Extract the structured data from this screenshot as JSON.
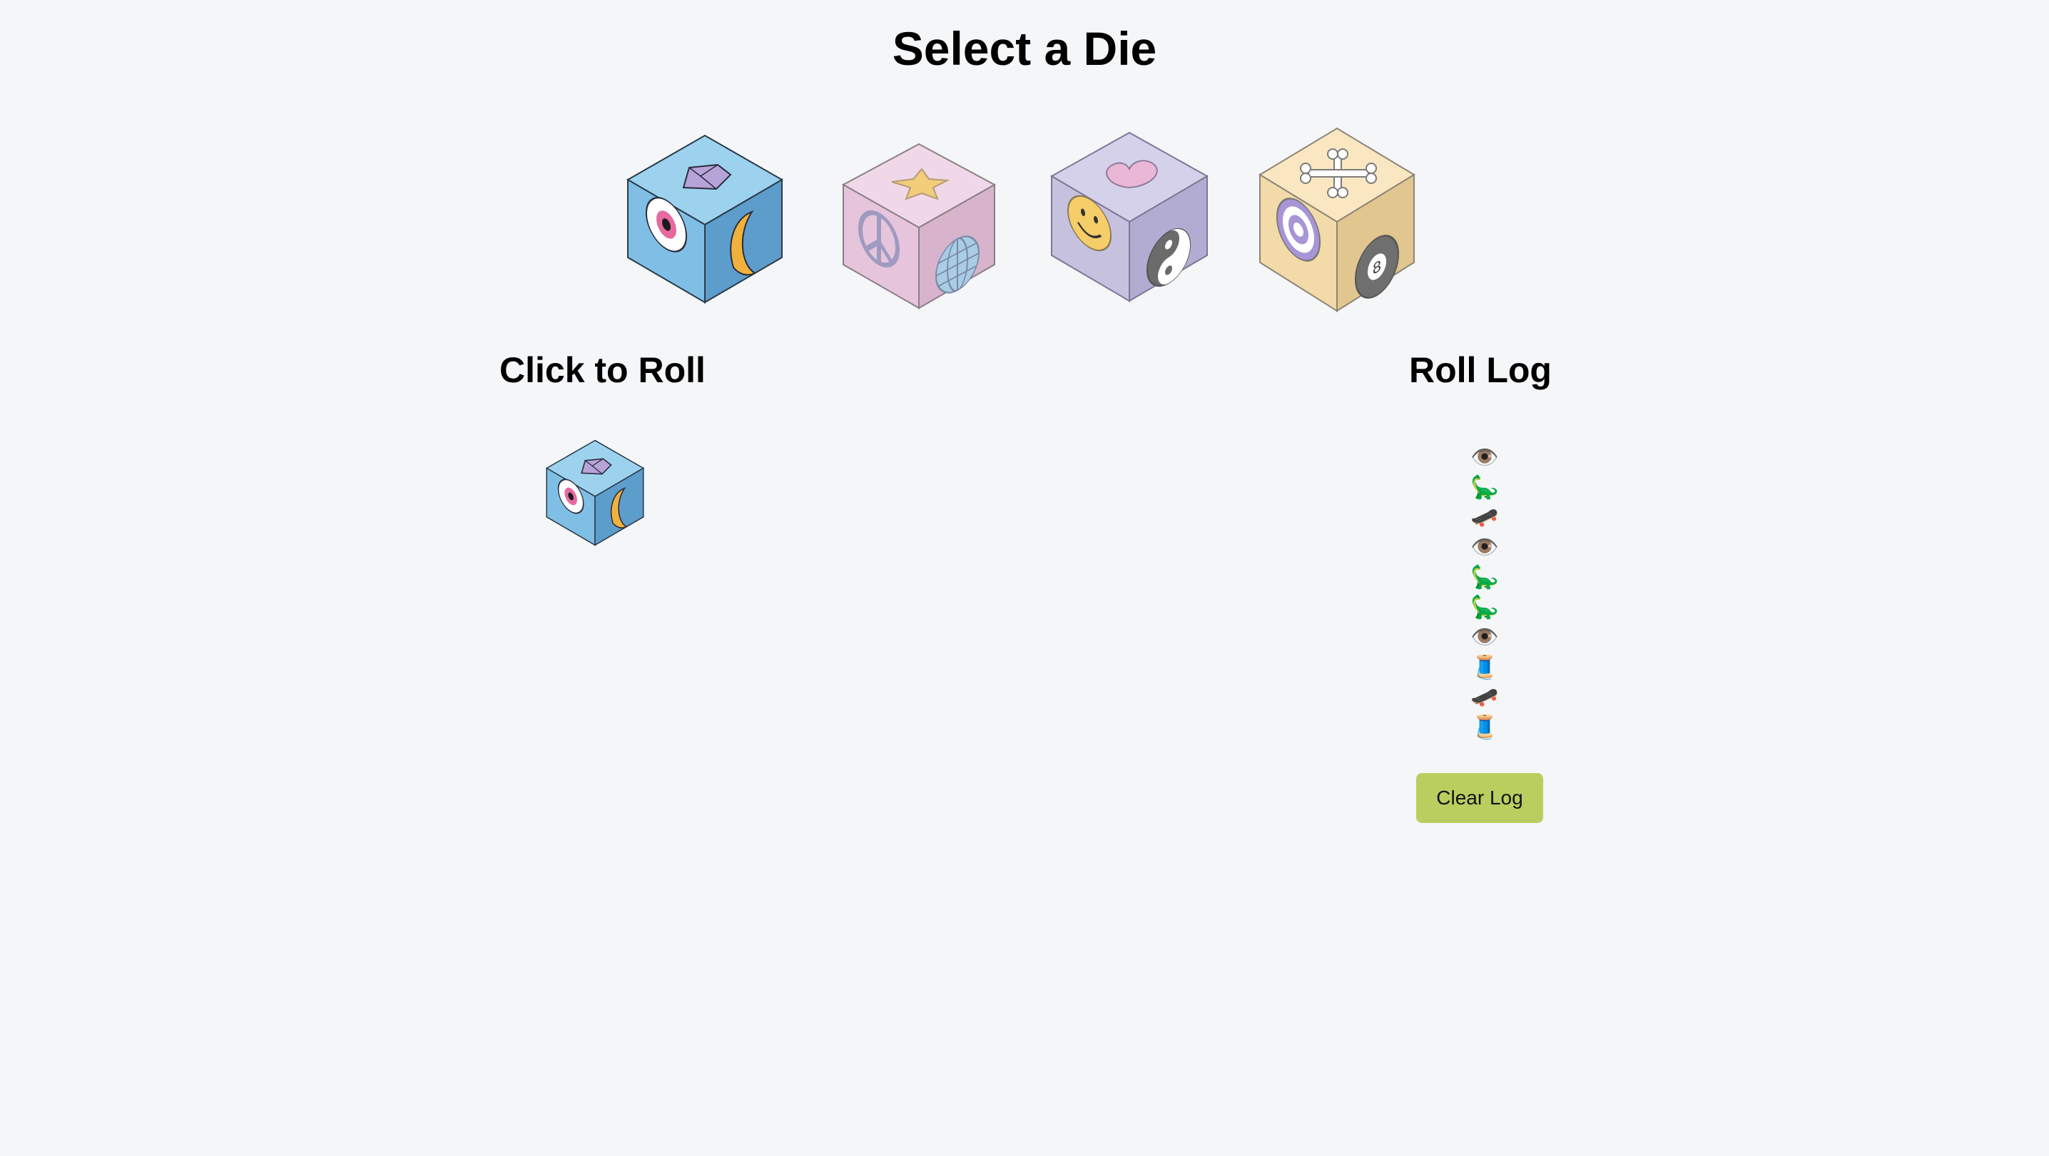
{
  "header": {
    "title": "Select a Die"
  },
  "dice": [
    {
      "name": "space-die",
      "top_face": "gem-icon",
      "left_face": "eye-icon",
      "right_face": "moon-icon",
      "colors": {
        "top": "#9dd2ee",
        "left": "#7fbfe6",
        "right": "#5c9dcb"
      }
    },
    {
      "name": "pink-die",
      "top_face": "star-icon",
      "left_face": "peace-icon",
      "right_face": "globe-icon",
      "colors": {
        "top": "#f0d8e8",
        "left": "#e6c5dc",
        "right": "#d8b3cc"
      }
    },
    {
      "name": "lavender-die",
      "top_face": "heart-icon",
      "left_face": "smiley-icon",
      "right_face": "yin-yang-icon",
      "colors": {
        "top": "#d6d1ea",
        "left": "#c7c1e0",
        "right": "#b3acd2"
      }
    },
    {
      "name": "cream-die",
      "top_face": "bone-icon",
      "left_face": "target-icon",
      "right_face": "eight-ball-icon",
      "colors": {
        "top": "#fae7c2",
        "left": "#f2dba8",
        "right": "#e1c68f"
      }
    }
  ],
  "roll": {
    "title": "Click to Roll"
  },
  "log": {
    "title": "Roll Log",
    "entries": [
      "👁️",
      "🦕",
      "🛹",
      "👁️",
      "🦕",
      "🦕",
      "👁️",
      "🧵",
      "🛹",
      "🧵"
    ],
    "clear_label": "Clear Log"
  },
  "colors": {
    "background": "#f4f6f8",
    "button": "#b8cf5f"
  }
}
